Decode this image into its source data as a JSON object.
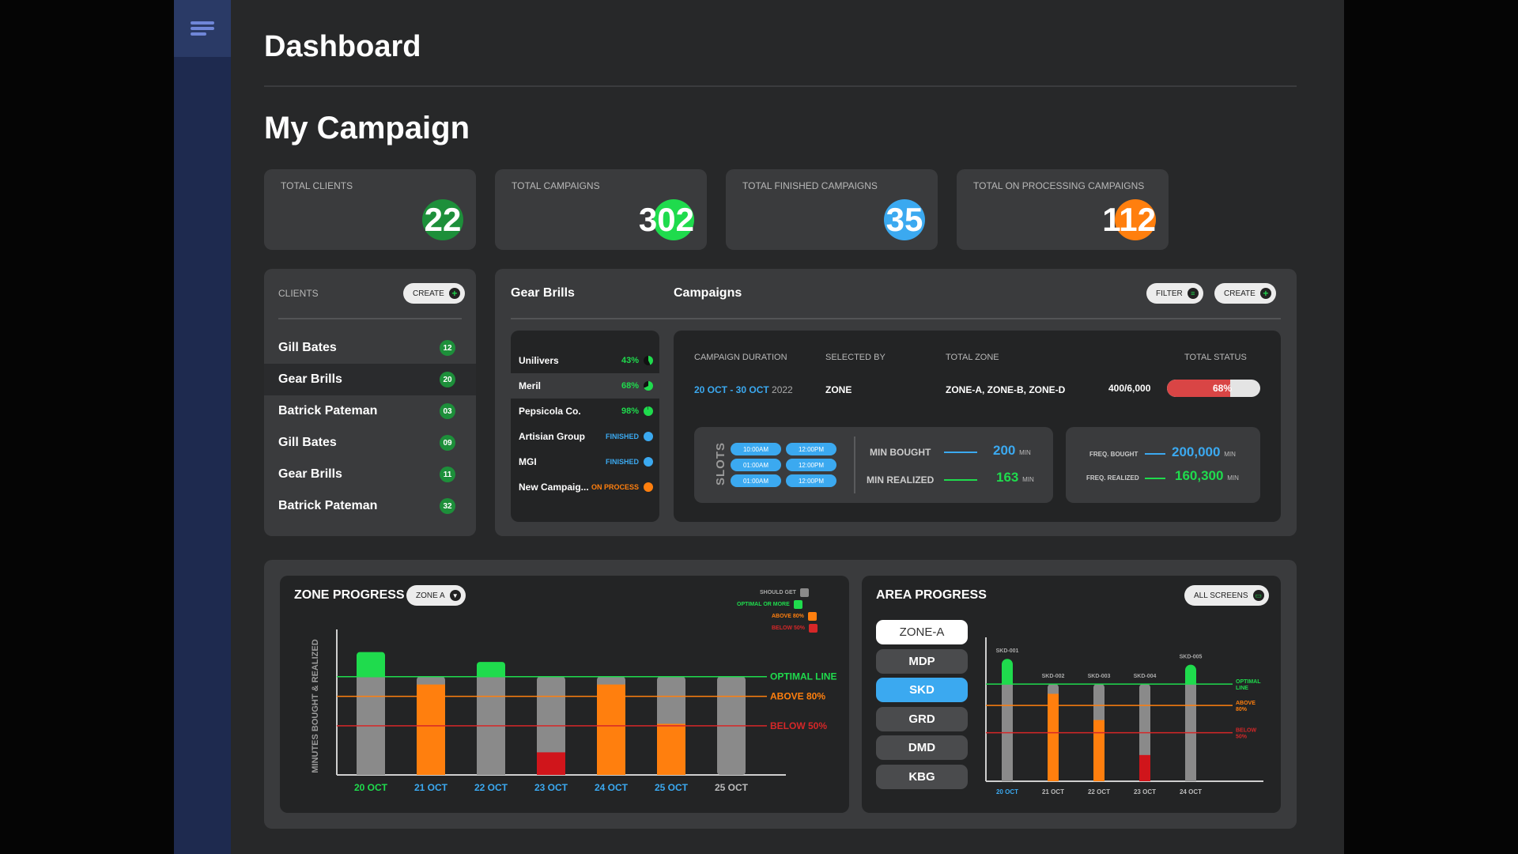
{
  "page": {
    "title": "Dashboard",
    "section_title": "My Campaign"
  },
  "stats": [
    {
      "label": "TOTAL CLIENTS",
      "value": "22",
      "color": "#1d8f3a"
    },
    {
      "label": "TOTAL CAMPAIGNS",
      "value": "302",
      "color": "#1fdb4d"
    },
    {
      "label": "TOTAL FINISHED CAMPAIGNS",
      "value": "35",
      "color": "#3ba9f0"
    },
    {
      "label": "TOTAL ON PROCESSING CAMPAIGNS",
      "value": "112",
      "color": "#ff7f0e"
    }
  ],
  "clients": {
    "header": "CLIENTS",
    "create_label": "CREATE",
    "items": [
      {
        "name": "Gill Bates",
        "count": "12"
      },
      {
        "name": "Gear Brills",
        "count": "20"
      },
      {
        "name": "Batrick Pateman",
        "count": "03"
      },
      {
        "name": "Gill Bates",
        "count": "09"
      },
      {
        "name": "Gear Brills",
        "count": "11"
      },
      {
        "name": "Batrick Pateman",
        "count": "32"
      }
    ]
  },
  "campaigns": {
    "client_title": "Gear Brills",
    "title": "Campaigns",
    "filter_label": "FILTER",
    "create_label": "CREATE",
    "list": [
      {
        "name": "Unilivers",
        "status": "43%",
        "color": "#1fdb4d"
      },
      {
        "name": "Meril",
        "status": "68%",
        "color": "#1fdb4d"
      },
      {
        "name": "Pepsicola Co.",
        "status": "98%",
        "color": "#1fdb4d"
      },
      {
        "name": "Artisian Group",
        "status": "FINISHED",
        "color": "#3ba9f0"
      },
      {
        "name": "MGI",
        "status": "FINISHED",
        "color": "#3ba9f0"
      },
      {
        "name": "New Campaig...",
        "status": "ON PROCESS",
        "color": "#ff7f0e"
      }
    ],
    "detail": {
      "duration_header": "CAMPAIGN DURATION",
      "selected_header": "SELECTED BY",
      "zone_header": "TOTAL ZONE",
      "status_header": "TOTAL STATUS",
      "duration_dates": "20 OCT - 30 OCT",
      "duration_year": "2022",
      "selected_by": "ZONE",
      "zones": "ZONE-A, ZONE-B, ZONE-D",
      "status_count": "400/6,000",
      "status_percent": "68%",
      "status_fraction": 0.68
    },
    "slots": {
      "label": "SLOTS",
      "times": [
        "10:00AM",
        "12:00PM",
        "01:00AM",
        "12:00PM",
        "01:00AM",
        "12:00PM"
      ]
    },
    "minutes": {
      "bought_label": "MIN BOUGHT",
      "bought_value": "200",
      "realized_label": "MIN REALIZED",
      "realized_value": "163",
      "unit": "MIN"
    },
    "freq": {
      "bought_label": "FREQ. BOUGHT",
      "bought_value": "200,000",
      "realized_label": "FREQ. REALIZED",
      "realized_value": "160,300",
      "unit": "MIN"
    }
  },
  "zone_progress": {
    "title": "ZONE PROGRESS",
    "dropdown": "ZONE A",
    "legend": [
      {
        "label": "SHOULD GET",
        "color": "#8a8a8a"
      },
      {
        "label": "OPTIMAL OR MORE",
        "color": "#1fdb4d"
      },
      {
        "label": "ABOVE 80%",
        "color": "#ff7f0e"
      },
      {
        "label": "BELOW 50%",
        "color": "#d62728"
      }
    ]
  },
  "area_progress": {
    "title": "AREA PROGRESS",
    "dropdown": "ALL SCREENS",
    "zones": [
      "ZONE-A",
      "MDP",
      "SKD",
      "GRD",
      "DMD",
      "KBG"
    ],
    "active_zone": "ZONE-A",
    "selected_zone": "SKD"
  },
  "chart_data": [
    {
      "type": "bar",
      "title": "ZONE PROGRESS",
      "ylabel": "MINUTES BOUGHT & REALIZED",
      "categories": [
        "20 OCT",
        "21 OCT",
        "22 OCT",
        "23 OCT",
        "24 OCT",
        "25 OCT",
        "25 OCT"
      ],
      "series": [
        {
          "name": "SHOULD GET",
          "values": [
            100,
            100,
            100,
            100,
            100,
            100,
            100
          ]
        },
        {
          "name": "OPTIMAL OR MORE",
          "values": [
            125,
            0,
            115,
            0,
            0,
            0,
            0
          ]
        },
        {
          "name": "ABOVE 80%",
          "values": [
            0,
            92,
            0,
            0,
            92,
            52,
            0
          ]
        },
        {
          "name": "BELOW 50%",
          "values": [
            0,
            0,
            0,
            23,
            0,
            0,
            0
          ]
        }
      ],
      "reference_lines": [
        {
          "label": "OPTIMAL LINE",
          "value": 100,
          "color": "#1fdb4d"
        },
        {
          "label": "ABOVE 80%",
          "value": 80,
          "color": "#ff7f0e"
        },
        {
          "label": "BELOW 50%",
          "value": 50,
          "color": "#d62728"
        }
      ],
      "ylim": [
        0,
        140
      ],
      "category_colors": [
        "#1fdb4d",
        "#3ba9f0",
        "#3ba9f0",
        "#3ba9f0",
        "#3ba9f0",
        "#3ba9f0",
        "#bbbbbb"
      ]
    },
    {
      "type": "bar",
      "title": "AREA PROGRESS",
      "categories": [
        "20 OCT",
        "21 OCT",
        "22 OCT",
        "23 OCT",
        "24 OCT"
      ],
      "bar_labels": [
        "SKD-001",
        "SKD-002",
        "SKD-003",
        "SKD-004",
        "SKD-005"
      ],
      "series": [
        {
          "name": "SHOULD GET",
          "values": [
            100,
            100,
            100,
            100,
            100
          ]
        },
        {
          "name": "OPTIMAL OR MORE",
          "values": [
            126,
            0,
            0,
            0,
            120
          ]
        },
        {
          "name": "ABOVE 80%",
          "values": [
            0,
            90,
            63,
            0,
            0
          ]
        },
        {
          "name": "BELOW 50%",
          "values": [
            0,
            0,
            0,
            27,
            0
          ]
        }
      ],
      "reference_lines": [
        {
          "label": "OPTIMAL LINE",
          "value": 100,
          "color": "#1fdb4d"
        },
        {
          "label": "ABOVE 80%",
          "value": 78,
          "color": "#ff7f0e"
        },
        {
          "label": "BELOW 50%",
          "value": 50,
          "color": "#d62728"
        }
      ],
      "ylim": [
        0,
        140
      ],
      "category_colors": [
        "#3ba9f0",
        "#bbbbbb",
        "#bbbbbb",
        "#bbbbbb",
        "#bbbbbb"
      ]
    }
  ]
}
